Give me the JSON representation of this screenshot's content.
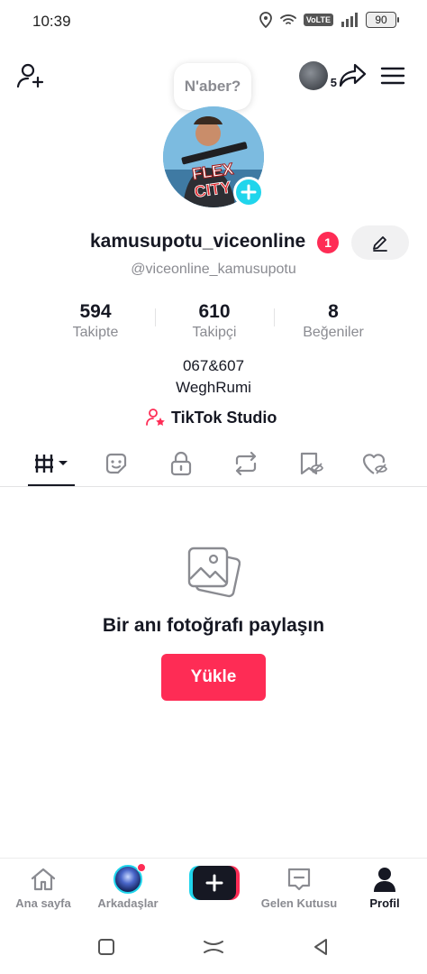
{
  "status_bar": {
    "time": "10:39",
    "network_badge": "VoLTE",
    "battery": "90"
  },
  "top_bar": {
    "mini_avatar_count": "5",
    "bubble_text": "N'aber?"
  },
  "profile": {
    "username": "kamusupotu_viceonline",
    "notification_count": "1",
    "handle": "@viceonline_kamusupotu",
    "avatar_text": "FLEX CITY"
  },
  "stats": [
    {
      "value": "594",
      "label": "Takipte"
    },
    {
      "value": "610",
      "label": "Takipçi"
    },
    {
      "value": "8",
      "label": "Beğeniler"
    }
  ],
  "bio": {
    "line1": "067&607",
    "line2": "WeghRumi"
  },
  "studio_link": "TikTok Studio",
  "tabs": [
    "videos-grid",
    "stickers",
    "private",
    "reposts",
    "favorites",
    "liked"
  ],
  "empty_state": {
    "text": "Bir anı fotoğrafı paylaşın",
    "button": "Yükle"
  },
  "bottom_nav": [
    {
      "label": "Ana sayfa"
    },
    {
      "label": "Arkadaşlar"
    },
    {
      "label": ""
    },
    {
      "label": "Gelen Kutusu"
    },
    {
      "label": "Profil"
    }
  ],
  "colors": {
    "accent_red": "#fe2c55",
    "accent_cyan": "#20d5ec",
    "text": "#161823",
    "muted": "#8a8b91"
  }
}
